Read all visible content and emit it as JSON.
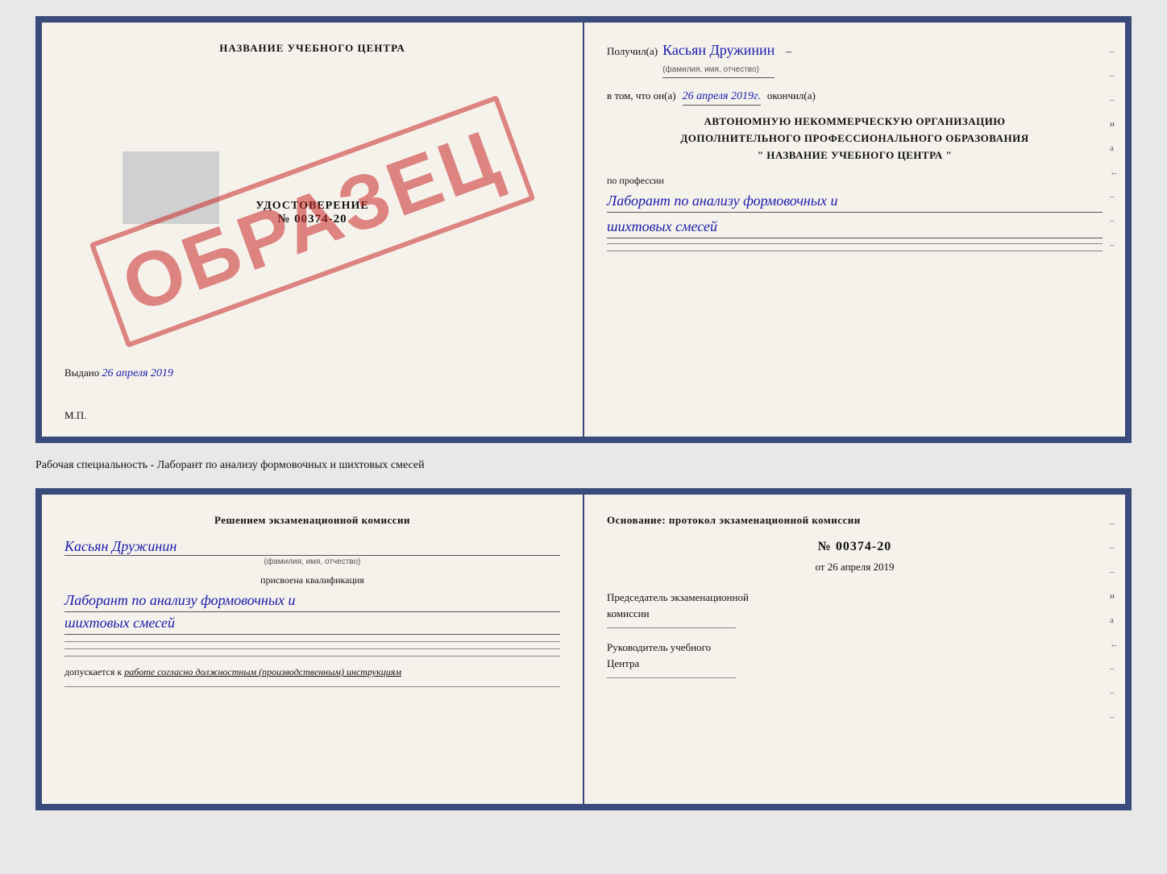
{
  "top_card": {
    "left": {
      "title": "НАЗВАНИЕ УЧЕБНОГО ЦЕНТРА",
      "obrazec": "ОБРАЗЕЦ",
      "grey_box": "",
      "udostoverenie": "УДОСТОВЕРЕНИЕ",
      "number": "№ 00374-20",
      "vydano_label": "Выдано",
      "vydano_date": "26 апреля 2019",
      "mp": "М.П."
    },
    "right": {
      "poluchil": "Получил(а)",
      "name": "Касьян Дружинин",
      "name_subtitle": "(фамилия, имя, отчество)",
      "vtom_label": "в том, что он(а)",
      "date_value": "26 апреля 2019г.",
      "okonchil": "окончил(а)",
      "avt_line1": "АВТОНОМНУЮ НЕКОММЕРЧЕСКУЮ ОРГАНИЗАЦИЮ",
      "avt_line2": "ДОПОЛНИТЕЛЬНОГО ПРОФЕССИОНАЛЬНОГО ОБРАЗОВАНИЯ",
      "avt_line3": "\"    НАЗВАНИЕ УЧЕБНОГО ЦЕНТРА    \"",
      "po_professii": "по профессии",
      "professiya_line1": "Лаборант по анализу формовочных и",
      "professiya_line2": "шихтовых смесей",
      "right_marks": [
        "–",
        "–",
        "–",
        "и",
        "а",
        "←",
        "–",
        "–",
        "–"
      ]
    }
  },
  "separator": {
    "text": "Рабочая специальность - Лаборант по анализу формовочных и шихтовых смесей"
  },
  "bottom_card": {
    "left": {
      "resheniem": "Решением  экзаменационной  комиссии",
      "fio_hand": "Касьян  Дружинин",
      "fio_subtitle": "(фамилия, имя, отчество)",
      "prisvoena": "присвоена квалификация",
      "kval_line1": "Лаборант по анализу формовочных и",
      "kval_line2": "шихтовых смесей",
      "dopuskaetsya": "допускается к",
      "dopusk_italic": "работе согласно должностным (производственным) инструкциям"
    },
    "right": {
      "osnovanie": "Основание: протокол экзаменационной  комиссии",
      "number": "№  00374-20",
      "ot_label": "от",
      "ot_date": "26 апреля 2019",
      "predsedatel_line1": "Председатель экзаменационной",
      "predsedatel_line2": "комиссии",
      "rukovoditel_line1": "Руководитель учебного",
      "rukovoditel_line2": "Центра",
      "right_marks": [
        "–",
        "–",
        "–",
        "и",
        "а",
        "←",
        "–",
        "–",
        "–"
      ]
    }
  }
}
